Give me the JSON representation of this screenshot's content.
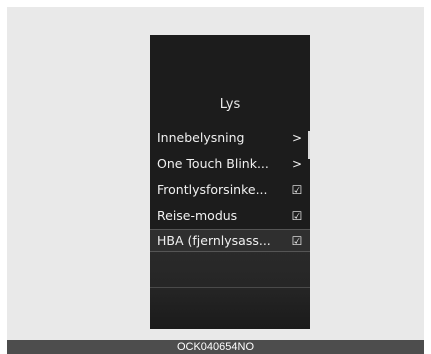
{
  "menu": {
    "title": "Lys",
    "items": [
      {
        "label": "Innebelysning",
        "icon": "chevron-right-icon",
        "glyph": ">"
      },
      {
        "label": "One Touch Blink...",
        "icon": "chevron-right-icon",
        "glyph": ">"
      },
      {
        "label": "Frontlysforsinke...",
        "icon": "checkbox-checked-icon",
        "glyph": "☑"
      },
      {
        "label": "Reise-modus",
        "icon": "checkbox-checked-icon",
        "glyph": "☑"
      },
      {
        "label": "HBA (fjernlysass...",
        "icon": "checkbox-checked-icon",
        "glyph": "☑"
      }
    ]
  },
  "caption": "OCK040654NO",
  "colors": {
    "background": "#e9e9e9",
    "cluster": "#1c1c1c",
    "text": "#f0f0f0",
    "caption_bar": "#4d4d4d"
  }
}
